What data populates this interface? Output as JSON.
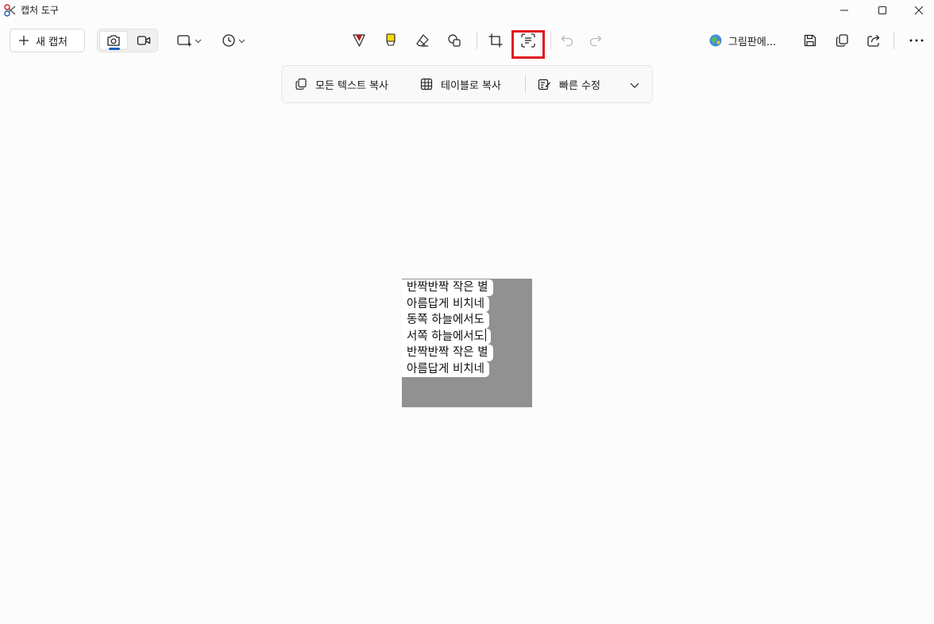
{
  "window": {
    "title": "캡처 도구",
    "icons": [
      "app-icon",
      "minimize-icon",
      "maximize-icon",
      "close-icon"
    ]
  },
  "toolbar": {
    "new_capture_label": "새 캡처",
    "paint_label": "그림판에...",
    "active_mode": "photo",
    "highlighted_tool": "text-actions",
    "accent_color": "#1460c6",
    "highlight_color": "#e0161e",
    "icons": [
      "camera-icon",
      "video-icon",
      "rectangle-snip-icon",
      "timer-icon",
      "pen-icon",
      "highlighter-icon",
      "eraser-icon",
      "shapes-icon",
      "crop-icon",
      "text-actions-icon",
      "undo-icon",
      "redo-icon",
      "paint-icon",
      "save-icon",
      "copy-icon",
      "share-icon",
      "more-icon"
    ]
  },
  "text_actions": {
    "copy_all_text": "모든 텍스트 복사",
    "copy_as_table": "테이블로 복사",
    "quick_redact": "빠른 수정"
  },
  "capture": {
    "background_color": "#919191",
    "lines": [
      "반짝반짝 작은 별",
      "아름답게 비치네",
      "동쪽 하늘에서도",
      "서쪽 하늘에서도",
      "반짝반짝 작은 별",
      "아름답게 비치네"
    ]
  }
}
